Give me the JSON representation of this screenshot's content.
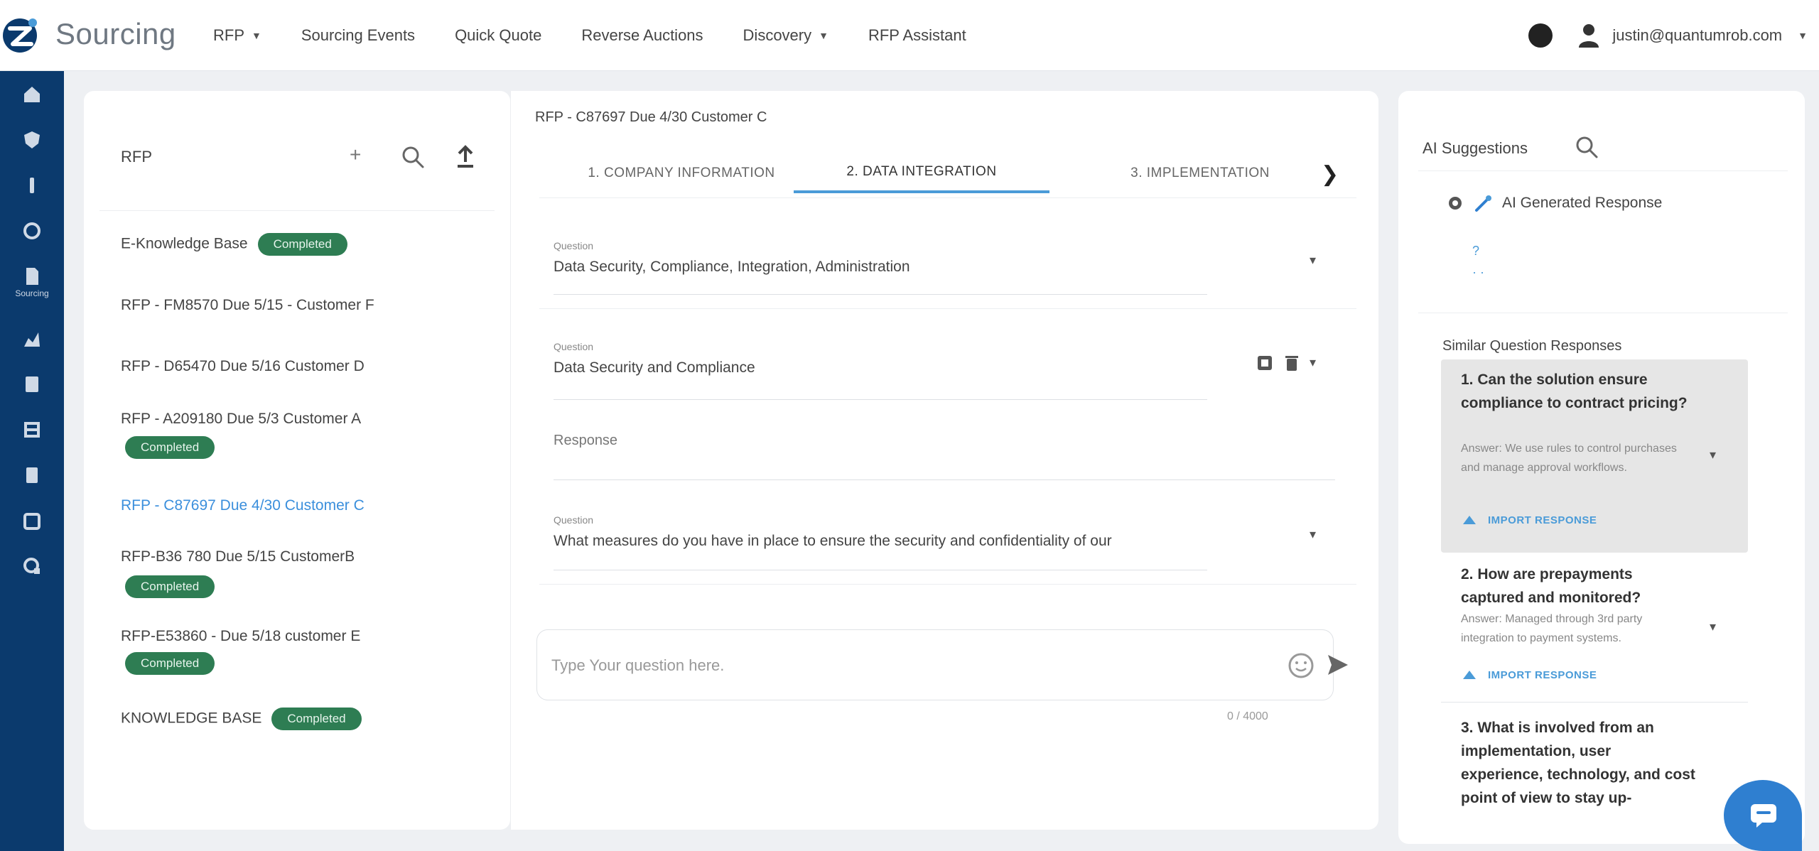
{
  "app": {
    "title": "Sourcing"
  },
  "nav": {
    "items": [
      {
        "label": "RFP",
        "caret": true
      },
      {
        "label": "Sourcing Events",
        "caret": false
      },
      {
        "label": "Quick Quote",
        "caret": false
      },
      {
        "label": "Reverse Auctions",
        "caret": false
      },
      {
        "label": "Discovery",
        "caret": true
      },
      {
        "label": "RFP Assistant",
        "caret": false
      }
    ],
    "user_email": "justin@quantumrob.com"
  },
  "rail": {
    "icons": [
      "home-icon",
      "shield-icon",
      "dollar-icon",
      "clock-icon",
      "document-icon",
      "chart-icon",
      "list-icon",
      "grid-icon",
      "file-icon",
      "calendar-icon",
      "gear-chart-icon"
    ],
    "active_label": "Sourcing"
  },
  "left_panel": {
    "header": "RFP",
    "plus": "+",
    "items": [
      {
        "label": "E-Knowledge Base",
        "badge": "Completed",
        "badge_inline": true,
        "active": false
      },
      {
        "label": "RFP - FM8570 Due 5/15 - Customer F",
        "badge": null,
        "active": false
      },
      {
        "label": "RFP - D65470 Due 5/16 Customer D",
        "badge": null,
        "active": false
      },
      {
        "label": "RFP - A209180 Due 5/3 Customer A",
        "badge": "Completed",
        "badge_inline": false,
        "active": false
      },
      {
        "label": "RFP - C87697 Due 4/30 Customer C",
        "badge": null,
        "active": true
      },
      {
        "label": "RFP-B36 780 Due 5/15 CustomerB",
        "badge": "Completed",
        "badge_inline": false,
        "active": false
      },
      {
        "label": "RFP-E53860 - Due 5/18 customer E",
        "badge": "Completed",
        "badge_inline": false,
        "active": false
      },
      {
        "label": "KNOWLEDGE BASE",
        "badge": "Completed",
        "badge_inline": true,
        "active": false
      }
    ]
  },
  "main": {
    "title": "RFP - C87697 Due 4/30 Customer C",
    "tabs": [
      {
        "label": "1. COMPANY INFORMATION",
        "active": false
      },
      {
        "label": "2. DATA INTEGRATION",
        "active": true
      },
      {
        "label": "3. IMPLEMENTATION",
        "active": false
      }
    ],
    "questions": [
      {
        "label": "Question",
        "text": "Data Security, Compliance, Integration, Administration"
      },
      {
        "label": "Question",
        "text": "Data Security and Compliance"
      },
      {
        "label": "Question",
        "text": "What measures do you have in place to ensure the security and confidentiality of our"
      }
    ],
    "response_label": "Response",
    "chat": {
      "placeholder": "Type Your question here.",
      "char_count": "0 / 4000"
    }
  },
  "right_panel": {
    "title": "AI Suggestions",
    "ai_generated_label": "AI Generated Response",
    "ai_dots": [
      "?",
      "· ·"
    ],
    "similar_title": "Similar Question Responses",
    "similar": [
      {
        "question": "1. Can the solution ensure compliance to contract pricing?",
        "answer": "Answer: We use rules to control purchases and manage approval workflows.",
        "import_label": "IMPORT RESPONSE"
      },
      {
        "question": "2. How are prepayments captured and monitored?",
        "answer": "Answer: Managed through 3rd party integration to payment systems.",
        "import_label": "IMPORT RESPONSE"
      },
      {
        "question": "3. What is involved from an implementation, user experience, technology, and cost point of view to stay up-",
        "answer": "",
        "import_label": ""
      }
    ]
  },
  "colors": {
    "rail_bg": "#0b3a6d",
    "badge_green": "#2e7d53",
    "accent_blue": "#4a9bd8",
    "active_link": "#3b8fdc",
    "fab_blue": "#2f7fd0"
  }
}
